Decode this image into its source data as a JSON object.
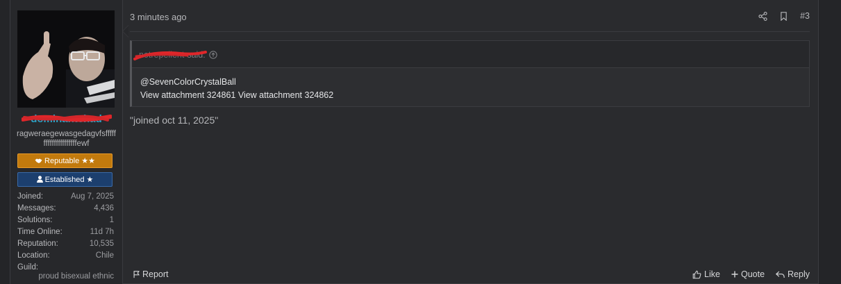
{
  "user": {
    "username": "dominantchad",
    "title": "ragweraegewasgedagvfsfffffffffffffffffffffewf",
    "banners": {
      "reputable": "Reputable ★★",
      "established": "Established ★"
    },
    "stats": [
      {
        "key": "Joined:",
        "value": "Aug 7, 2025"
      },
      {
        "key": "Messages:",
        "value": "4,436"
      },
      {
        "key": "Solutions:",
        "value": "1"
      },
      {
        "key": "Time Online:",
        "value": "11d 7h"
      },
      {
        "key": "Reputation:",
        "value": "10,535"
      },
      {
        "key": "Location:",
        "value": "Chile"
      },
      {
        "key": "Guild:",
        "value": ""
      }
    ],
    "guild_value": "proud bisexual ethnic",
    "colors": {
      "username": "#29a3c7",
      "reputable": "#c27a0d",
      "established": "#1c3f6e"
    }
  },
  "post": {
    "timestamp": "3 minutes ago",
    "number": "#3",
    "quote": {
      "author": "notrepellent",
      "said": "said:",
      "lines": [
        "@SevenColorCrystalBall",
        "View attachment 324861 View attachment 324862"
      ]
    },
    "text": "\"joined oct 11, 2025\"",
    "actions": {
      "report": "Report",
      "like": "Like",
      "quote": "Quote",
      "reply": "Reply"
    }
  },
  "icons": [
    "share-icon",
    "bookmark-icon",
    "flag-icon",
    "thumbs-up-icon",
    "plus-icon",
    "reply-icon",
    "arrow-up-circle-icon",
    "handshake-icon",
    "user-icon"
  ]
}
